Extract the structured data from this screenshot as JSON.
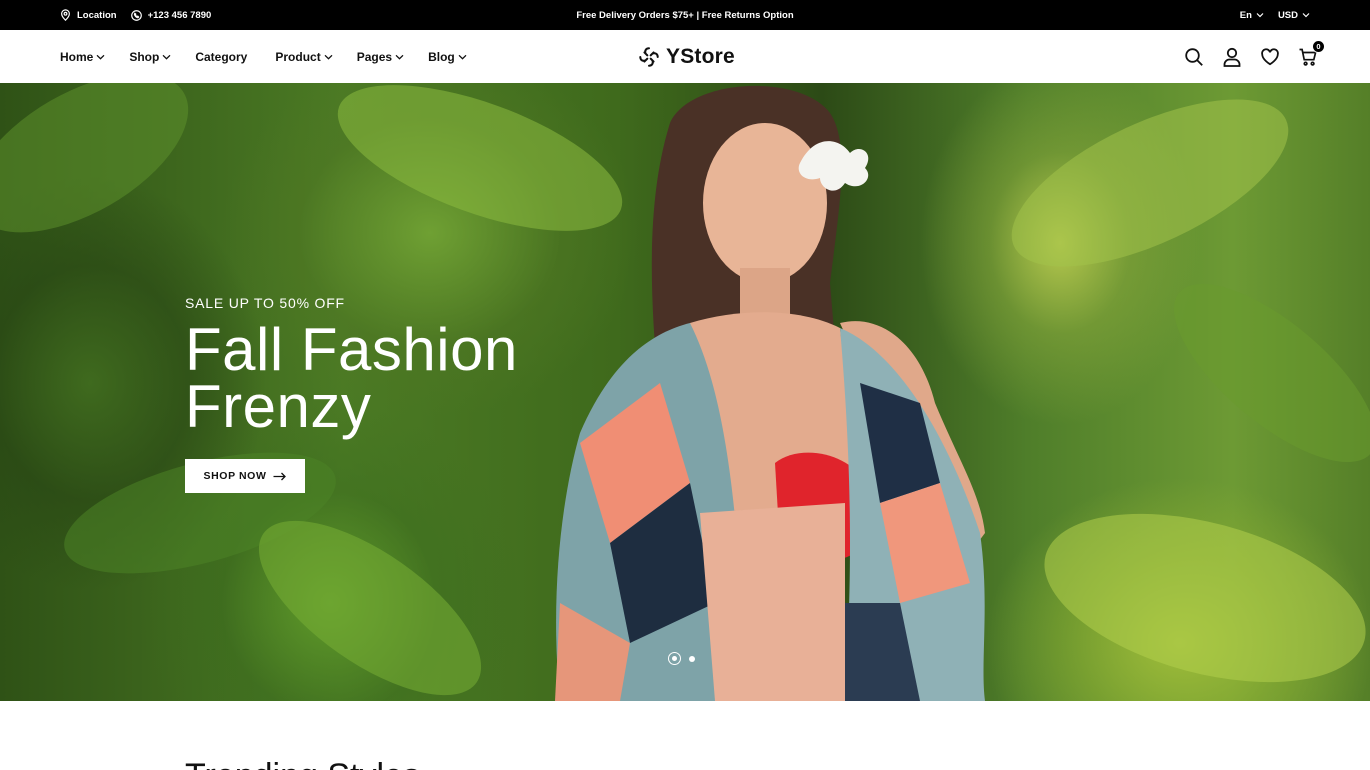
{
  "topbar": {
    "location": "Location",
    "phone": "+123 456 7890",
    "promo": "Free Delivery Orders $75+ | Free Returns Option",
    "language": "En",
    "currency": "USD"
  },
  "nav": {
    "items": [
      {
        "label": "Home",
        "dropdown": true
      },
      {
        "label": "Shop",
        "dropdown": true
      },
      {
        "label": "Category",
        "dropdown": false
      },
      {
        "label": "Product",
        "dropdown": true
      },
      {
        "label": "Pages",
        "dropdown": true
      },
      {
        "label": "Blog",
        "dropdown": true
      }
    ]
  },
  "brand": {
    "name": "YStore"
  },
  "header_actions": {
    "icons": [
      "search-icon",
      "user-icon",
      "heart-icon",
      "cart-icon"
    ],
    "cart_count": "0"
  },
  "hero": {
    "eyebrow": "SALE UP TO 50% OFF",
    "headline": "Fall Fashion Frenzy",
    "cta_label": "SHOP NOW",
    "slides_total": 2,
    "active_slide": 1
  },
  "next_section": {
    "title": "Trending Styles"
  },
  "colors": {
    "topbar_bg": "#000000",
    "text": "#111111",
    "hero_text": "#ffffff",
    "button_bg": "#ffffff"
  }
}
